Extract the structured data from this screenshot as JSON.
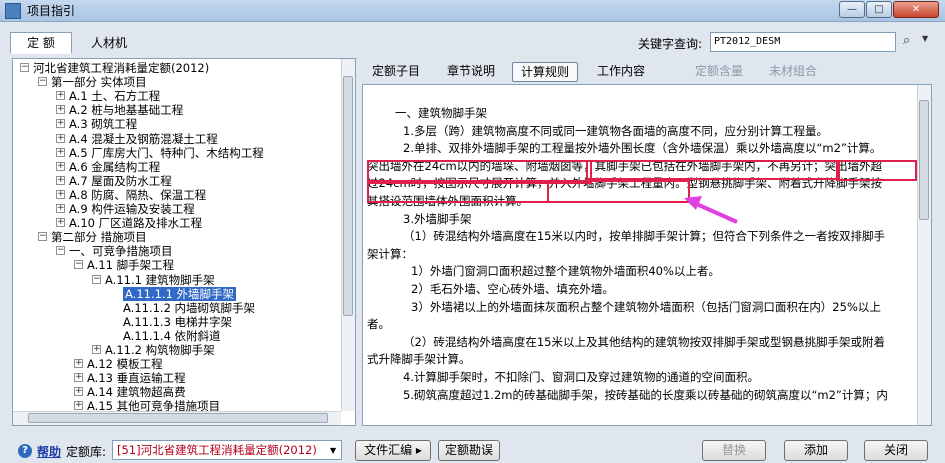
{
  "window": {
    "title": "项目指引",
    "min": "—",
    "max": "□",
    "close": "✕"
  },
  "top_tabs": [
    "定 额",
    "人材机"
  ],
  "keyword": {
    "label": "关键字查询:",
    "value": "PT2012_DESM"
  },
  "tree": [
    {
      "depth": 0,
      "exp": "−",
      "text": "河北省建筑工程消耗量定额(2012)"
    },
    {
      "depth": 1,
      "exp": "−",
      "text": "第一部分 实体项目"
    },
    {
      "depth": 2,
      "exp": "+",
      "text": "A.1 土、石方工程"
    },
    {
      "depth": 2,
      "exp": "+",
      "text": "A.2 桩与地基基础工程"
    },
    {
      "depth": 2,
      "exp": "+",
      "text": "A.3 砌筑工程"
    },
    {
      "depth": 2,
      "exp": "+",
      "text": "A.4 混凝土及钢筋混凝土工程"
    },
    {
      "depth": 2,
      "exp": "+",
      "text": "A.5 厂库房大门、特种门、木结构工程"
    },
    {
      "depth": 2,
      "exp": "+",
      "text": "A.6 金属结构工程"
    },
    {
      "depth": 2,
      "exp": "+",
      "text": "A.7 屋面及防水工程"
    },
    {
      "depth": 2,
      "exp": "+",
      "text": "A.8 防腐、隔热、保温工程"
    },
    {
      "depth": 2,
      "exp": "+",
      "text": "A.9 构件运输及安装工程"
    },
    {
      "depth": 2,
      "exp": "+",
      "text": "A.10 厂区道路及排水工程"
    },
    {
      "depth": 1,
      "exp": "−",
      "text": "第二部分 措施项目"
    },
    {
      "depth": 2,
      "exp": "−",
      "text": "一、可竞争措施项目"
    },
    {
      "depth": 3,
      "exp": "−",
      "text": "A.11 脚手架工程"
    },
    {
      "depth": 4,
      "exp": "−",
      "text": "A.11.1 建筑物脚手架"
    },
    {
      "depth": 5,
      "exp": "",
      "text": "A.11.1.1 外墙脚手架",
      "selected": true
    },
    {
      "depth": 5,
      "exp": "",
      "text": "A.11.1.2 内墙砌筑脚手架"
    },
    {
      "depth": 5,
      "exp": "",
      "text": "A.11.1.3 电梯井字架"
    },
    {
      "depth": 5,
      "exp": "",
      "text": "A.11.1.4 依附斜道"
    },
    {
      "depth": 4,
      "exp": "+",
      "text": "A.11.2 构筑物脚手架"
    },
    {
      "depth": 3,
      "exp": "+",
      "text": "A.12 模板工程"
    },
    {
      "depth": 3,
      "exp": "+",
      "text": "A.13 垂直运输工程"
    },
    {
      "depth": 3,
      "exp": "+",
      "text": "A.14 建筑物超高费"
    },
    {
      "depth": 3,
      "exp": "+",
      "text": "A.15 其他可竞争措施项目"
    }
  ],
  "right_tabs": [
    "定额子目",
    "章节说明",
    "计算规则",
    "工作内容",
    "定额含量",
    "未材组合"
  ],
  "doc_lines": [
    "一、建筑物脚手架",
    "1.多层（跨）建筑物高度不同或同一建筑物各面墙的高度不同，应分别计算工程量。",
    "2.单排、双排外墙脚手架的工程量按外墙外围长度（含外墙保温）乘以外墙高度以“m2”计算。",
    "突出墙外在24cm以内的墙垛、附墙烟囱等，其脚手架已包括在外墙脚手架内，不再另计；突出墙外超",
    "过24cm时，按图示尺寸展开计算，并入外墙脚手架工程量内。型钢悬挑脚手架、附着式升降脚手架按",
    "其搭设范围墙体外围面积计算。",
    "3.外墙脚手架",
    "（1）砖混结构外墙高度在15米以内时，按单排脚手架计算；但符合下列条件之一者按双排脚手",
    "架计算：",
    "1）外墙门窗洞口面积超过整个建筑物外墙面积40%以上者。",
    "2）毛石外墙、空心砖外墙、填充外墙。",
    "3）外墙裙以上的外墙面抹灰面积占整个建筑物外墙面积（包括门窗洞口面积在内）25%以上",
    "者。",
    "（2）砖混结构外墙高度在15米以上及其他结构的建筑物按双排脚手架或型钢悬挑脚手架或附着",
    "式升降脚手架计算。",
    "4.计算脚手架时，不扣除门、窗洞口及穿过建筑物的通道的空间面积。",
    "5.砌筑高度超过1.2m的砖基础脚手架，按砖基础的长度乘以砖基础的砌筑高度以“m2”计算；内"
  ],
  "bottom": {
    "help_link": "帮助",
    "lib_label": "定额库:",
    "lib_value": "[51]河北省建筑工程消耗量定额(2012)",
    "btn_wenjian": "文件汇编 ▸",
    "btn_kanwu": "定额勘误",
    "btn_tihuan": "替换",
    "btn_tianjia": "添加",
    "btn_guanbi": "关闭"
  },
  "colors": {
    "highlight": "#e0204a",
    "arrow": "#e040e0",
    "selection": "#3169c6"
  }
}
